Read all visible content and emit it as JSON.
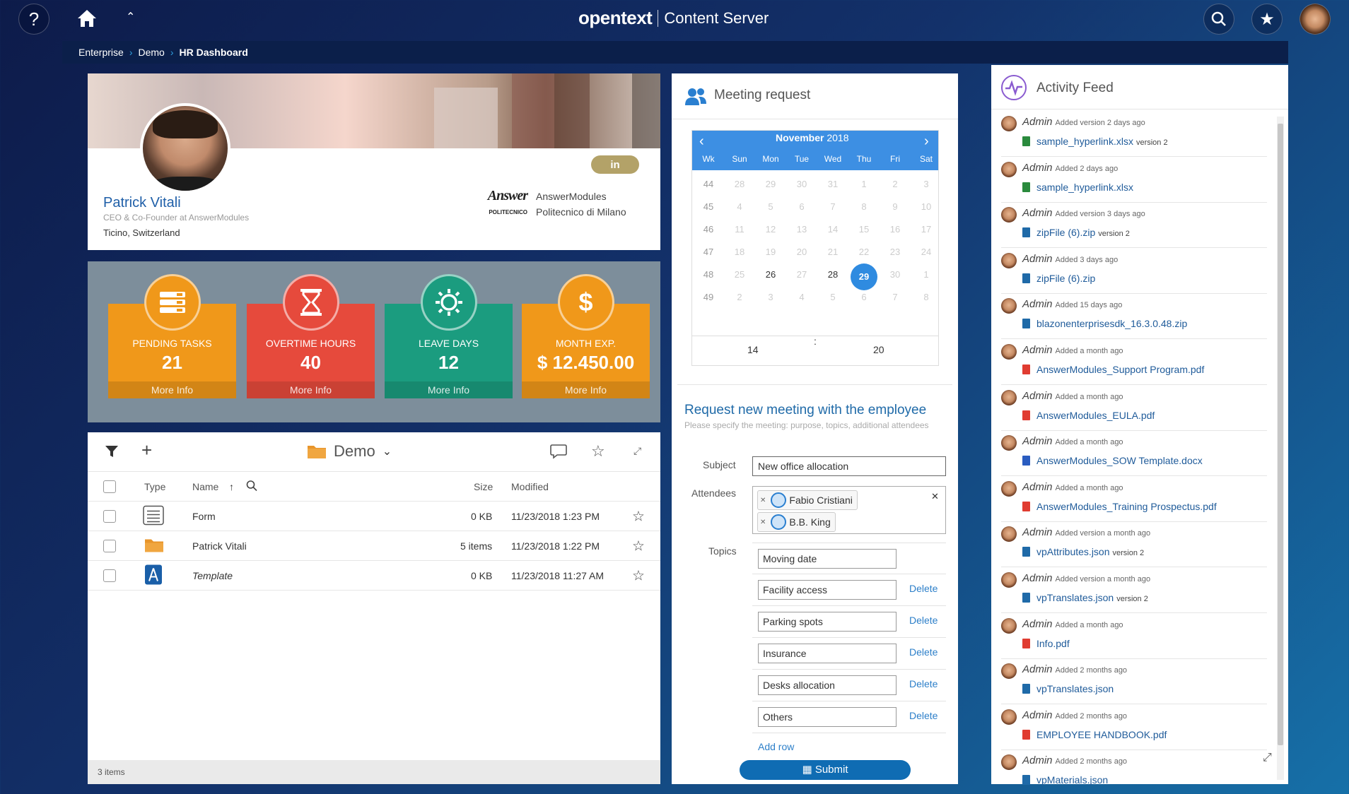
{
  "app": {
    "brand": "opentext",
    "product": "Content Server"
  },
  "breadcrumb": {
    "items": [
      "Enterprise",
      "Demo"
    ],
    "current": "HR Dashboard"
  },
  "profile": {
    "name": "Patrick Vitali",
    "role": "CEO & Co-Founder at AnswerModules",
    "location": "Ticino, Switzerland",
    "linkedin_label": "in",
    "orgs": [
      {
        "logo_text": "Answer",
        "name": "AnswerModules"
      },
      {
        "logo_text": "POLITECNICO",
        "name": "Politecnico di Milano"
      }
    ]
  },
  "kpis": [
    {
      "label": "PENDING TASKS",
      "value": "21",
      "more": "More Info",
      "color": "#f0981a",
      "icon": "list-icon"
    },
    {
      "label": "OVERTIME HOURS",
      "value": "40",
      "more": "More Info",
      "color": "#e64a3c",
      "icon": "hourglass-icon"
    },
    {
      "label": "LEAVE DAYS",
      "value": "12",
      "more": "More Info",
      "color": "#1b9c7f",
      "icon": "sun-icon"
    },
    {
      "label": "MONTH EXP.",
      "value": "$ 12.450.00",
      "more": "More Info",
      "color": "#f0981a",
      "icon": "dollar-icon"
    }
  ],
  "browser": {
    "folder": "Demo",
    "columns": {
      "type": "Type",
      "name": "Name",
      "size": "Size",
      "modified": "Modified"
    },
    "rows": [
      {
        "name": "Form",
        "size": "0 KB",
        "modified": "11/23/2018 1:23 PM",
        "icon": "form-icon"
      },
      {
        "name": "Patrick Vitali",
        "size": "5 items",
        "modified": "11/23/2018 1:22 PM",
        "icon": "folder-icon"
      },
      {
        "name": "Template",
        "size": "0 KB",
        "modified": "11/23/2018 11:27 AM",
        "icon": "template-icon"
      }
    ],
    "footer": "3 items"
  },
  "meeting": {
    "title": "Meeting request",
    "calendar": {
      "month": "November",
      "year": "2018",
      "headers": [
        "Wk",
        "Sun",
        "Mon",
        "Tue",
        "Wed",
        "Thu",
        "Fri",
        "Sat"
      ],
      "weeks": [
        {
          "wk": "44",
          "days": [
            "28",
            "29",
            "30",
            "31",
            "1",
            "2",
            "3"
          ]
        },
        {
          "wk": "45",
          "days": [
            "4",
            "5",
            "6",
            "7",
            "8",
            "9",
            "10"
          ]
        },
        {
          "wk": "46",
          "days": [
            "11",
            "12",
            "13",
            "14",
            "15",
            "16",
            "17"
          ]
        },
        {
          "wk": "47",
          "days": [
            "18",
            "19",
            "20",
            "21",
            "22",
            "23",
            "24"
          ]
        },
        {
          "wk": "48",
          "days": [
            "25",
            "26",
            "27",
            "28",
            "29",
            "30",
            "1"
          ]
        },
        {
          "wk": "49",
          "days": [
            "2",
            "3",
            "4",
            "5",
            "6",
            "7",
            "8"
          ]
        }
      ],
      "enabled": [
        "26",
        "28"
      ],
      "selected": "29",
      "hour": "14",
      "minute": "20",
      "time_sep": ":"
    },
    "form_title": "Request new meeting with the employee",
    "form_subtitle": "Please specify the meeting: purpose, topics, additional attendees",
    "subject_label": "Subject",
    "subject_value": "New office allocation",
    "attendees_label": "Attendees",
    "attendees": [
      "Fabio Cristiani",
      "B.B. King"
    ],
    "topics_label": "Topics",
    "topics": [
      "Moving date",
      "Facility access",
      "Parking spots",
      "Insurance",
      "Desks allocation",
      "Others"
    ],
    "delete_label": "Delete",
    "add_row": "Add row",
    "submit": "Submit"
  },
  "feed": {
    "title": "Activity Feed",
    "items": [
      {
        "user": "Admin",
        "action": "Added version 2 days ago",
        "file": "sample_hyperlink.xlsx",
        "version": "version 2",
        "type": "xlsx"
      },
      {
        "user": "Admin",
        "action": "Added 2 days ago",
        "file": "sample_hyperlink.xlsx",
        "version": "",
        "type": "xlsx"
      },
      {
        "user": "Admin",
        "action": "Added version 3 days ago",
        "file": "zipFile (6).zip",
        "version": "version 2",
        "type": "zip"
      },
      {
        "user": "Admin",
        "action": "Added 3 days ago",
        "file": "zipFile (6).zip",
        "version": "",
        "type": "zip"
      },
      {
        "user": "Admin",
        "action": "Added 15 days ago",
        "file": "blazonenterprisesdk_16.3.0.48.zip",
        "version": "",
        "type": "zip"
      },
      {
        "user": "Admin",
        "action": "Added a month ago",
        "file": "AnswerModules_Support Program.pdf",
        "version": "",
        "type": "pdf"
      },
      {
        "user": "Admin",
        "action": "Added a month ago",
        "file": "AnswerModules_EULA.pdf",
        "version": "",
        "type": "pdf"
      },
      {
        "user": "Admin",
        "action": "Added a month ago",
        "file": "AnswerModules_SOW Template.docx",
        "version": "",
        "type": "docx"
      },
      {
        "user": "Admin",
        "action": "Added a month ago",
        "file": "AnswerModules_Training Prospectus.pdf",
        "version": "",
        "type": "pdf"
      },
      {
        "user": "Admin",
        "action": "Added version a month ago",
        "file": "vpAttributes.json",
        "version": "version 2",
        "type": "json"
      },
      {
        "user": "Admin",
        "action": "Added version a month ago",
        "file": "vpTranslates.json",
        "version": "version 2",
        "type": "json"
      },
      {
        "user": "Admin",
        "action": "Added a month ago",
        "file": "Info.pdf",
        "version": "",
        "type": "pdf"
      },
      {
        "user": "Admin",
        "action": "Added 2 months ago",
        "file": "vpTranslates.json",
        "version": "",
        "type": "json"
      },
      {
        "user": "Admin",
        "action": "Added 2 months ago",
        "file": "EMPLOYEE HANDBOOK.pdf",
        "version": "",
        "type": "pdf"
      },
      {
        "user": "Admin",
        "action": "Added 2 months ago",
        "file": "vpMaterials.json",
        "version": "",
        "type": "json"
      }
    ]
  }
}
